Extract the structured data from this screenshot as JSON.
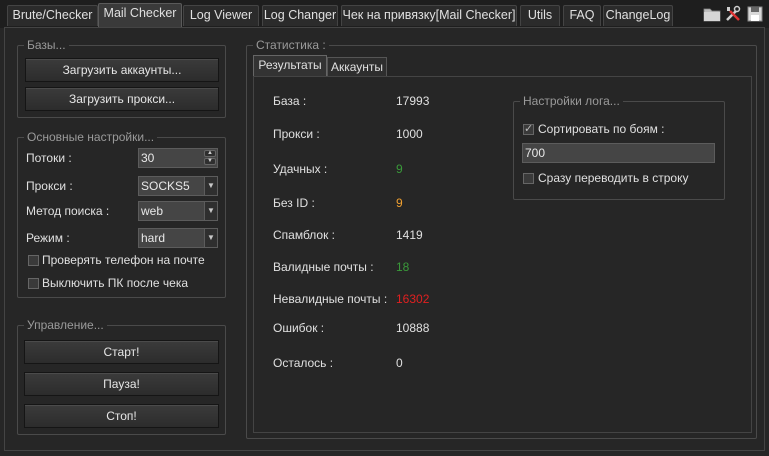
{
  "tabs": [
    {
      "label": "Brute/Checker"
    },
    {
      "label": "Mail Checker"
    },
    {
      "label": "Log  Viewer"
    },
    {
      "label": "Log Changer"
    },
    {
      "label": "Чек на привязку[Mail Checker]"
    },
    {
      "label": "Utils"
    },
    {
      "label": "FAQ"
    },
    {
      "label": "ChangeLog"
    }
  ],
  "toolbar": {
    "icons": [
      "folder-icon",
      "tools-icon",
      "save-icon"
    ]
  },
  "bases": {
    "title": "Базы...",
    "load_accounts": "Загрузить аккаунты...",
    "load_proxies": "Загрузить прокси..."
  },
  "settings": {
    "title": "Основные настройки...",
    "threads_label": "Потоки :",
    "threads_value": "30",
    "proxy_label": "Прокси :",
    "proxy_value": "SOCKS5",
    "search_label": "Метод поиска :",
    "search_value": "web",
    "mode_label": "Режим  :",
    "mode_value": "hard",
    "check_phone": {
      "label": "Проверять телефон на почте",
      "checked": false
    },
    "shutdown": {
      "label": "Выключить ПК после чека",
      "checked": false
    }
  },
  "control": {
    "title": "Управление...",
    "start": "Старт!",
    "pause": "Пауза!",
    "stop": "Стоп!"
  },
  "stats": {
    "title": "Статистика :",
    "tabs": [
      {
        "label": "Результаты"
      },
      {
        "label": "Аккаунты"
      }
    ],
    "rows": [
      {
        "label": "База :",
        "value": "17993",
        "color": "#e0e0e0"
      },
      {
        "label": "Прокси :",
        "value": "1000",
        "color": "#e0e0e0"
      },
      {
        "label": "Удачных :",
        "value": "9",
        "color": "#3a9a3a"
      },
      {
        "label": "Без ID :",
        "value": "9",
        "color": "#f0a030"
      },
      {
        "label": "Спамблок :",
        "value": "1419",
        "color": "#e0e0e0"
      },
      {
        "label": "Валидные почты :",
        "value": "18",
        "color": "#3a9a3a"
      },
      {
        "label": "Невалидные почты :",
        "value": "16302",
        "color": "#e02020"
      },
      {
        "label": "Ошибок :",
        "value": "10888",
        "color": "#e0e0e0"
      },
      {
        "label": "Осталось :",
        "value": "0",
        "color": "#e0e0e0"
      }
    ]
  },
  "log_settings": {
    "title": "Настройки лога...",
    "sort": {
      "label": "Сортировать по боям :",
      "checked": true
    },
    "sort_value": "700",
    "to_line": {
      "label": "Сразу переводить в строку",
      "checked": false
    }
  }
}
